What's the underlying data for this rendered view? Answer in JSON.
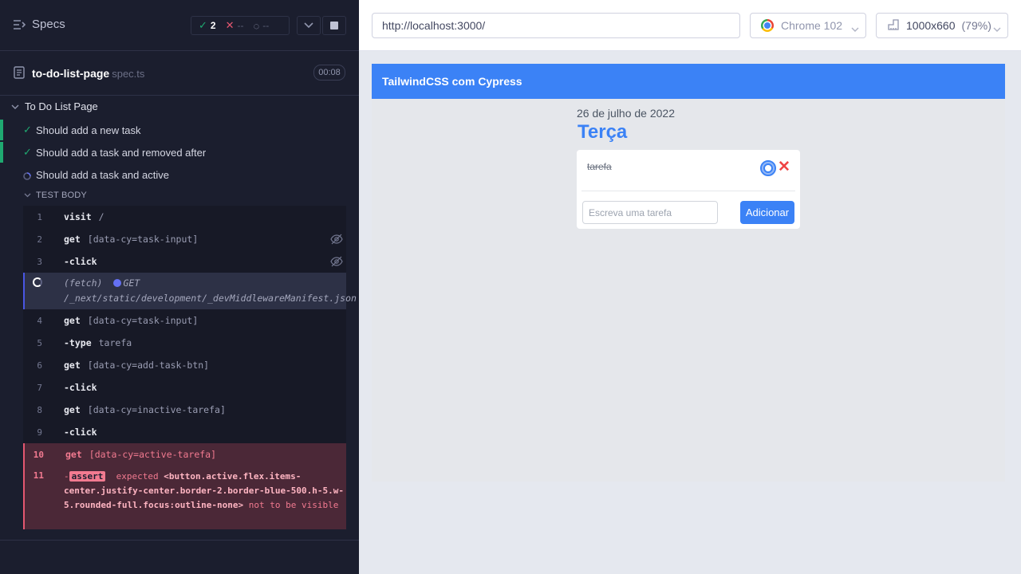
{
  "runner": {
    "specs_label": "Specs",
    "passed": "2",
    "failed": "--",
    "pending": "--",
    "spec_file": "to-do-list-page",
    "spec_ext": "spec.ts",
    "duration": "00:08",
    "suite": "To Do List Page",
    "tests": [
      {
        "label": "Should add a new task",
        "state": "passed"
      },
      {
        "label": "Should add a task and removed after",
        "state": "passed"
      },
      {
        "label": "Should add a task and active",
        "state": "running"
      }
    ],
    "test_body_label": "TEST BODY",
    "commands": [
      {
        "n": "1",
        "name": "visit",
        "arg": "/"
      },
      {
        "n": "2",
        "name": "get",
        "arg": "[data-cy=task-input]"
      },
      {
        "n": "3",
        "name": "-click",
        "arg": ""
      },
      {
        "n": "",
        "name": "(fetch)",
        "method": "GET",
        "url": "/_next/static/development/_devMiddlewareManifest.json"
      },
      {
        "n": "4",
        "name": "get",
        "arg": "[data-cy=task-input]"
      },
      {
        "n": "5",
        "name": "-type",
        "arg": "tarefa"
      },
      {
        "n": "6",
        "name": "get",
        "arg": "[data-cy=add-task-btn]"
      },
      {
        "n": "7",
        "name": "-click",
        "arg": ""
      },
      {
        "n": "8",
        "name": "get",
        "arg": "[data-cy=inactive-tarefa]"
      },
      {
        "n": "9",
        "name": "-click",
        "arg": ""
      },
      {
        "n": "10",
        "name": "get",
        "arg": "[data-cy=active-tarefa]"
      },
      {
        "n": "11",
        "name": "-",
        "tag": "assert",
        "expected": "expected",
        "element": "<button.active.flex.items-center.justify-center.border-2.border-blue-500.h-5.w-5.rounded-full.focus:outline-none>",
        "tail": "not to be visible"
      }
    ]
  },
  "browser_bar": {
    "url": "http://localhost:3000/",
    "browser": "Chrome 102",
    "viewport": "1000x660",
    "zoom": "(79%)"
  },
  "app": {
    "nav_title": "TailwindCSS com Cypress",
    "date": "26 de julho de 2022",
    "day": "Terça",
    "task": "tarefa",
    "remove_symbol": "✕",
    "input_placeholder": "Escreva uma tarefa",
    "add_button": "Adicionar"
  },
  "colors": {
    "runner_bg": "#1b1e2e",
    "pass": "#1fa971",
    "fail": "#e45770",
    "app_nav": "#3b82f6"
  }
}
